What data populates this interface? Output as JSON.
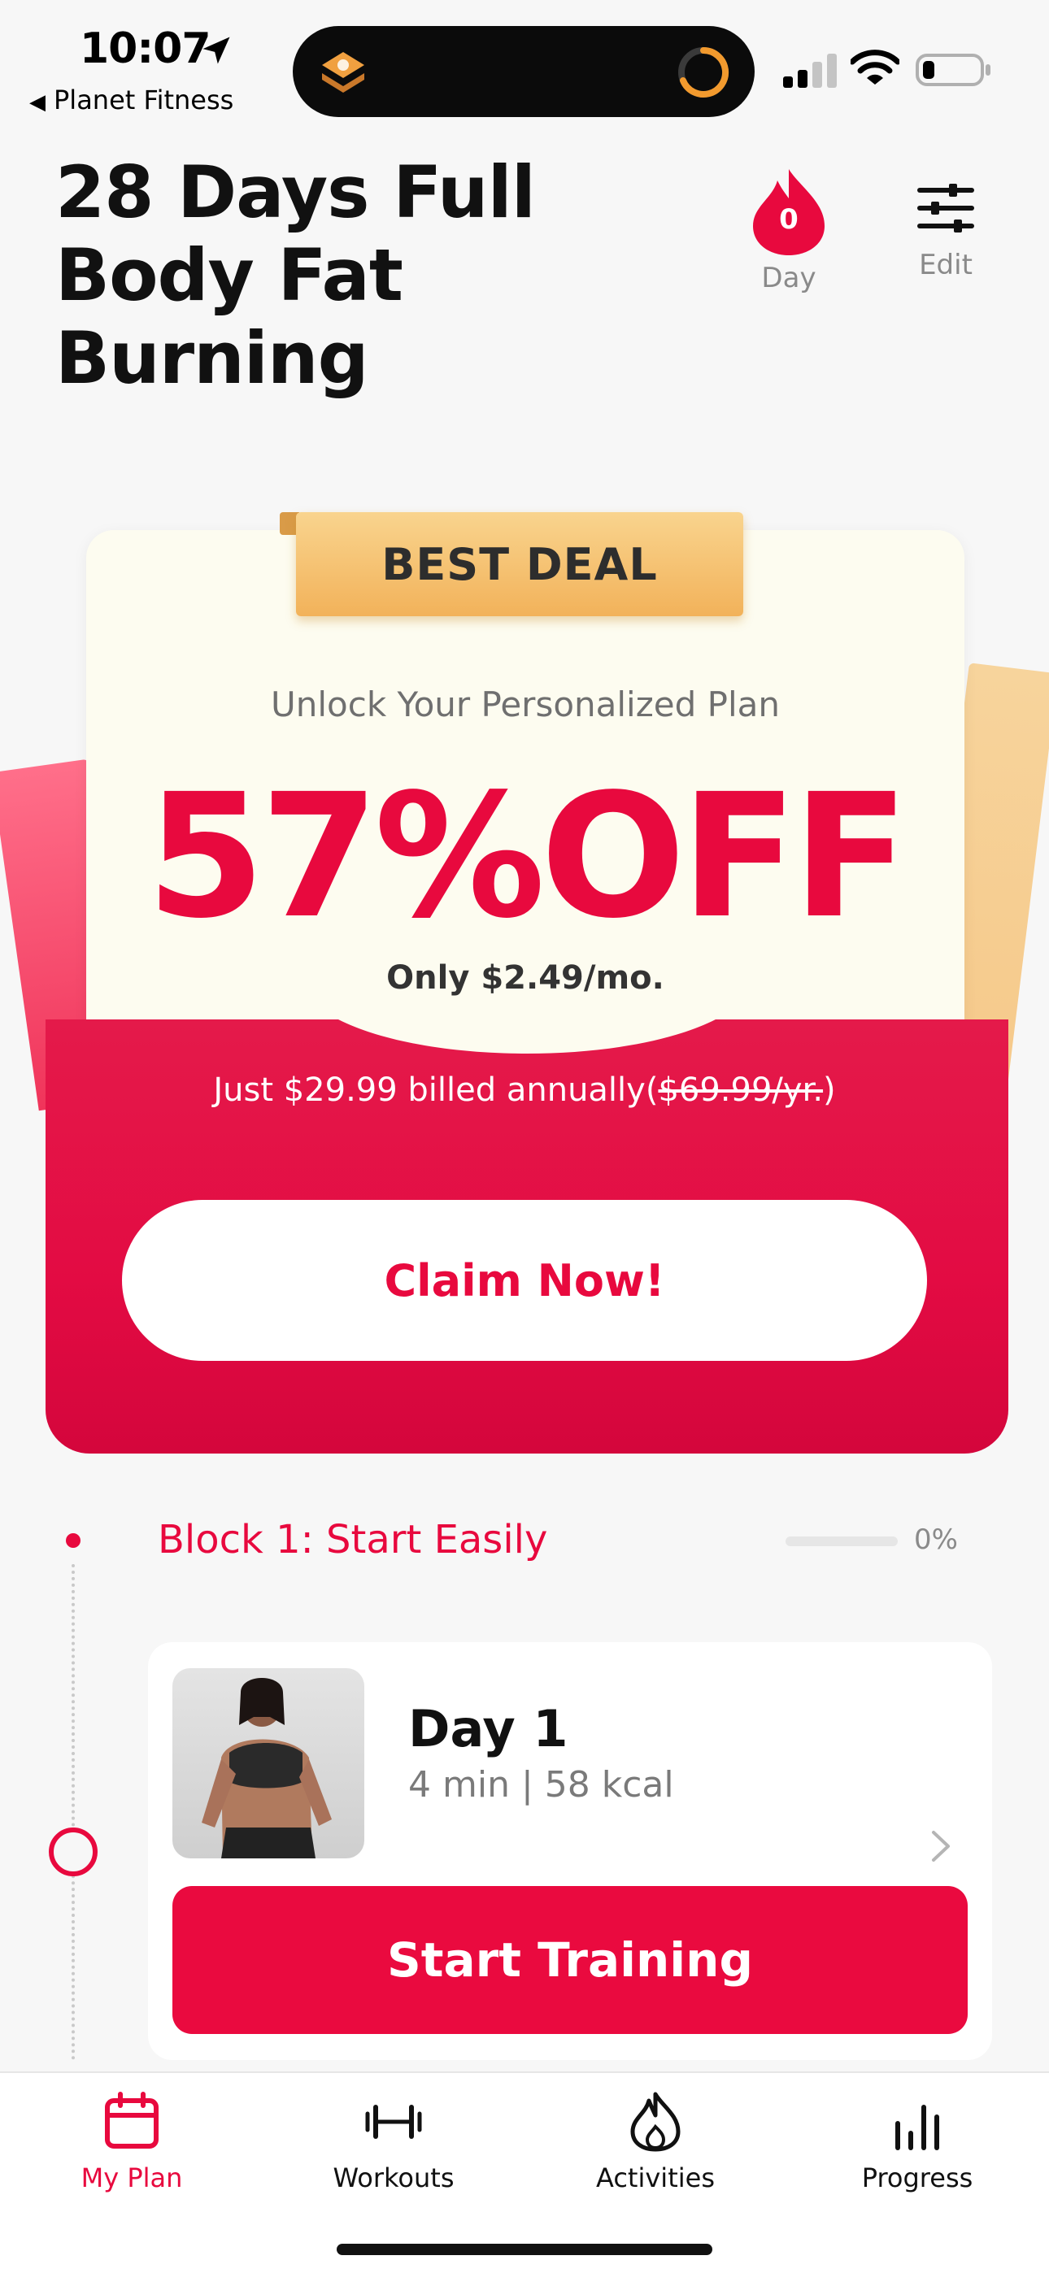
{
  "status_bar": {
    "time": "10:07",
    "back_app": "Planet Fitness"
  },
  "header": {
    "title": "28 Days Full Body Fat Burning",
    "day_count": "0",
    "day_label": "Day",
    "edit_label": "Edit"
  },
  "promo": {
    "ribbon": "BEST DEAL",
    "subtitle": "Unlock Your Personalized Plan",
    "discount": "57%OFF",
    "monthly": "Only $2.49/mo.",
    "billing_prefix": "Just $29.99 billed annually(",
    "billing_old_price": "$69.99/yr.",
    "billing_suffix": ")",
    "cta": "Claim Now!"
  },
  "block": {
    "title": "Block 1: Start Easily",
    "progress": 0,
    "percent_text": "0%"
  },
  "day_card": {
    "title": "Day 1",
    "meta": "4 min | 58 kcal",
    "cta": "Start Training"
  },
  "tabs": [
    {
      "label": "My Plan",
      "icon": "calendar-icon",
      "active": true
    },
    {
      "label": "Workouts",
      "icon": "dumbbell-icon",
      "active": false
    },
    {
      "label": "Activities",
      "icon": "flame-icon",
      "active": false
    },
    {
      "label": "Progress",
      "icon": "bar-chart-icon",
      "active": false
    }
  ],
  "colors": {
    "accent": "#e8093e",
    "ribbon": "#f2b25a",
    "inactive_text": "#8a8a8a"
  }
}
